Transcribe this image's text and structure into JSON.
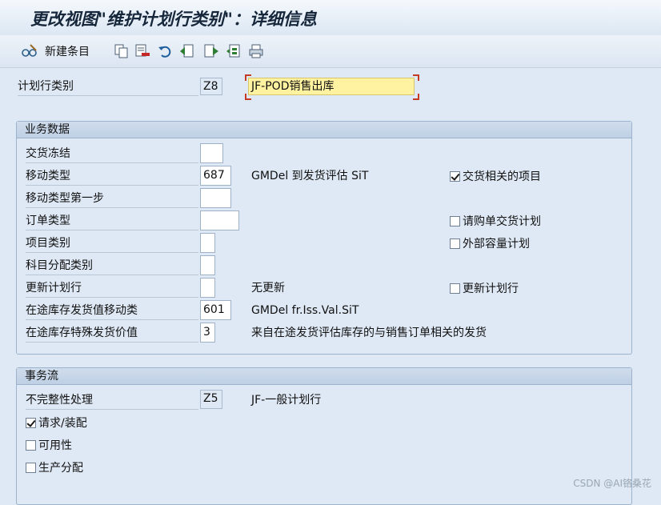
{
  "window": {
    "title": "更改视图\"维护计划行类别\"：详细信息"
  },
  "toolbar": {
    "new_entries_label": "新建条目"
  },
  "header": {
    "schedule_line_category": {
      "label": "计划行类别",
      "value": "Z8",
      "description": "JF-POD销售出库"
    }
  },
  "business_data": {
    "title": "业务数据",
    "delivery_block": {
      "label": "交货冻结",
      "value": ""
    },
    "movement_type": {
      "label": "移动类型",
      "value": "687",
      "description": "GMDel 到发货评估 SiT"
    },
    "movement_type_step1": {
      "label": "移动类型第一步",
      "value": ""
    },
    "order_type": {
      "label": "订单类型",
      "value": ""
    },
    "item_category": {
      "label": "项目类别",
      "value": ""
    },
    "account_assignment_category": {
      "label": "科目分配类别",
      "value": ""
    },
    "update_schedule_line": {
      "label": "更新计划行",
      "value": "",
      "description": "无更新"
    },
    "transit_stock_movement_type": {
      "label": "在途库存发货值移动类",
      "value": "601",
      "description": "GMDel fr.Iss.Val.SiT"
    },
    "transit_special_issue_value": {
      "label": "在途库存特殊发货价值",
      "value": "3",
      "description": "来自在途发货评估库存的与销售订单相关的发货"
    },
    "checkboxes": {
      "delivery_relevant": {
        "label": "交货相关的项目",
        "checked": true
      },
      "purchase_req_delivery_schedule": {
        "label": "请购单交货计划",
        "checked": false
      },
      "external_capacity_planning": {
        "label": "外部容量计划",
        "checked": false
      },
      "update_sched_lines": {
        "label": "更新计划行",
        "checked": false
      }
    }
  },
  "transaction_flow": {
    "title": "事务流",
    "incompletion_procedure": {
      "label": "不完整性处理",
      "value": "Z5",
      "description": "JF-一般计划行"
    },
    "checkboxes": {
      "requirements_assembly": {
        "label": "请求/装配",
        "checked": true
      },
      "availability": {
        "label": "可用性",
        "checked": false
      },
      "product_allocation": {
        "label": "生产分配",
        "checked": false
      }
    }
  },
  "watermark": "CSDN @AI铬桑花",
  "colors": {
    "background": "#dfe9f5",
    "highlight_field": "#fff2a0",
    "focus_corner": "#c23b22"
  }
}
